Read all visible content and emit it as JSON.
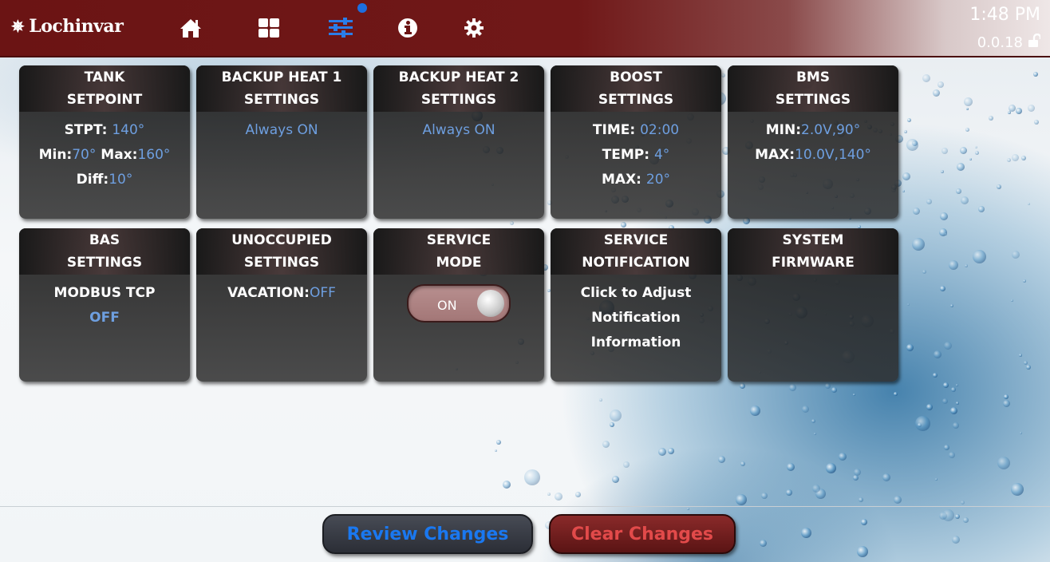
{
  "header": {
    "brand": "Lochinvar",
    "time": "1:48 PM",
    "version": "0.0.18",
    "nav": [
      {
        "name": "home-icon"
      },
      {
        "name": "dashboard-icon"
      },
      {
        "name": "settings-sliders-icon"
      },
      {
        "name": "info-icon"
      },
      {
        "name": "gear-icon"
      }
    ]
  },
  "tiles": {
    "tank_setpoint": {
      "title1": "TANK",
      "title2": "SETPOINT",
      "stpt_label": "STPT:",
      "stpt_value": "140°",
      "min_label": "Min:",
      "min_value": "70°",
      "max_label": "Max:",
      "max_value": "160°",
      "diff_label": "Diff:",
      "diff_value": "10°"
    },
    "backup_heat_1": {
      "title1": "BACKUP HEAT 1",
      "title2": "SETTINGS",
      "status": "Always ON"
    },
    "backup_heat_2": {
      "title1": "BACKUP HEAT 2",
      "title2": "SETTINGS",
      "status": "Always ON"
    },
    "boost": {
      "title1": "BOOST",
      "title2": "SETTINGS",
      "time_label": "TIME:",
      "time_value": "02:00",
      "temp_label": "TEMP:",
      "temp_value": "4°",
      "max_label": "MAX:",
      "max_value": "20°"
    },
    "bms": {
      "title1": "BMS",
      "title2": "SETTINGS",
      "min_label": "MIN:",
      "min_value": "2.0V,90°",
      "max_label": "MAX:",
      "max_value": "10.0V,140°"
    },
    "bas": {
      "title1": "BAS",
      "title2": "SETTINGS",
      "protocol": "MODBUS TCP",
      "status": "OFF"
    },
    "unoccupied": {
      "title1": "UNOCCUPIED",
      "title2": "SETTINGS",
      "vacation_label": "VACATION:",
      "vacation_value": "OFF"
    },
    "service_mode": {
      "title1": "SERVICE",
      "title2": "MODE",
      "toggle_label": "ON"
    },
    "service_notification": {
      "title1": "SERVICE",
      "title2": "NOTIFICATION",
      "line1": "Click to Adjust",
      "line2": "Notification",
      "line3": "Information"
    },
    "system_firmware": {
      "title1": "SYSTEM",
      "title2": "FIRMWARE"
    }
  },
  "footer": {
    "review_label": "Review Changes",
    "clear_label": "Clear Changes"
  },
  "colors": {
    "header_red": "#6b1414",
    "value_blue": "#6e9fe0",
    "review_blue": "#1a78f0",
    "clear_red": "#e24a4a"
  }
}
